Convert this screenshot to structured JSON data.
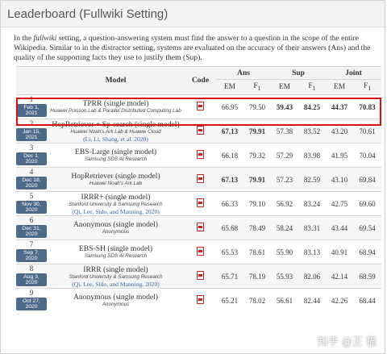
{
  "header": {
    "title": "Leaderboard (Fullwiki Setting)"
  },
  "intro": {
    "p1": "In the ",
    "em": "fullwiki",
    "p2": " setting, a question-answering system must find the answer to a question in the scope of the entire Wikipedia. Similar to in the distractor setting, systems are evaluated on the accuracy of their answers (Ans) and the quality of the supporting facts they use to justify them (Sup)."
  },
  "columns": {
    "model": "Model",
    "code": "Code",
    "ans": "Ans",
    "sup": "Sup",
    "joint": "Joint",
    "em": "EM",
    "f1": "F",
    "f1_sub": "1"
  },
  "rows": [
    {
      "rank": "1",
      "date": "Feb 1, 2021",
      "name": "TPRR (single model)",
      "inst": "Huawei Poisson Lab & Parallel Distributed Computing Lab",
      "cite": "",
      "ans_em": "66.95",
      "ans_f1": "79.50",
      "sup_em": "59.43",
      "sup_f1": "84.25",
      "joint_em": "44.37",
      "joint_f1": "70.83"
    },
    {
      "rank": "2",
      "date": "Jan 15, 2021",
      "name": "HopRetriever + Sp-search (single model)",
      "inst": "Huawei Noah's Ark Lab & Huawei Cloud",
      "cite": "(Li, Li, Shang, et al. 2020)",
      "ans_em": "67.13",
      "ans_f1": "79.91",
      "sup_em": "57.38",
      "sup_f1": "83.52",
      "joint_em": "43.20",
      "joint_f1": "70.61"
    },
    {
      "rank": "3",
      "date": "Dec 1, 2020",
      "name": "EBS-Large (single model)",
      "inst": "Samsung SDS AI Research",
      "cite": "",
      "ans_em": "66.18",
      "ans_f1": "79.32",
      "sup_em": "57.29",
      "sup_f1": "83.98",
      "joint_em": "41.95",
      "joint_f1": "70.04"
    },
    {
      "rank": "4",
      "date": "Dec 18, 2020",
      "name": "HopRetriever (single model)",
      "inst": "Huawei Noah's Ark Lab",
      "cite": "",
      "ans_em": "67.13",
      "ans_f1": "79.91",
      "sup_em": "57.23",
      "sup_f1": "82.59",
      "joint_em": "43.10",
      "joint_f1": "69.84"
    },
    {
      "rank": "5",
      "date": "Nov 30, 2020",
      "name": "IRRR+ (single model)",
      "inst": "Stanford University & Samsung Research",
      "cite": "(Qi, Lee, Sido, and Manning, 2020)",
      "ans_em": "66.33",
      "ans_f1": "79.10",
      "sup_em": "56.92",
      "sup_f1": "83.24",
      "joint_em": "42.75",
      "joint_f1": "69.60"
    },
    {
      "rank": "6",
      "date": "Dec 31, 2020",
      "name": "Anonymous (single model)",
      "inst": "Anonymous",
      "cite": "",
      "ans_em": "65.68",
      "ans_f1": "78.49",
      "sup_em": "58.24",
      "sup_f1": "83.31",
      "joint_em": "43.44",
      "joint_f1": "69.54"
    },
    {
      "rank": "7",
      "date": "Sep 7, 2020",
      "name": "EBS-SH (single model)",
      "inst": "Samsung SDS AI Research",
      "cite": "",
      "ans_em": "65.53",
      "ans_f1": "78.61",
      "sup_em": "55.90",
      "sup_f1": "83.13",
      "joint_em": "40.91",
      "joint_f1": "68.94"
    },
    {
      "rank": "8",
      "date": "Aug 3, 2020",
      "name": "IRRR (single model)",
      "inst": "Stanford University & Samsung Research",
      "cite": "(Qi, Lee, Sido, and Manning, 2020)",
      "ans_em": "65.71",
      "ans_f1": "78.19",
      "sup_em": "55.93",
      "sup_f1": "82.06",
      "joint_em": "42.14",
      "joint_f1": "68.59"
    },
    {
      "rank": "9",
      "date": "Oct 27, 2020",
      "name": "Anonymous (single model)",
      "inst": "Anonymous",
      "cite": "",
      "ans_em": "65.21",
      "ans_f1": "78.02",
      "sup_em": "56.61",
      "sup_f1": "82.44",
      "joint_em": "42.26",
      "joint_f1": "68.44"
    }
  ],
  "bold": {
    "1": [
      "sup_em",
      "sup_f1",
      "joint_em",
      "joint_f1"
    ],
    "2": [
      "ans_em",
      "ans_f1"
    ],
    "4": [
      "ans_em",
      "ans_f1"
    ]
  },
  "highlight_color": "#dd1111",
  "watermark": "知乎 @王 猫"
}
